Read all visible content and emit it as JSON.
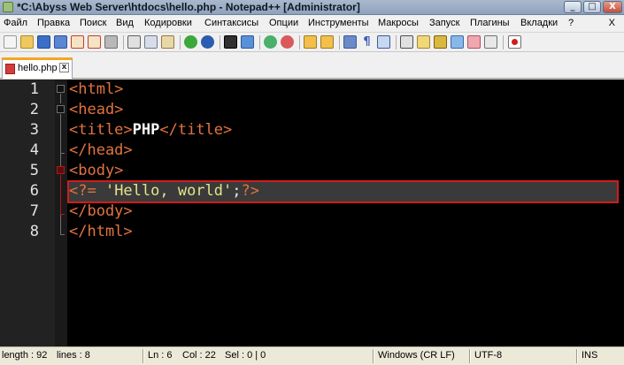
{
  "window": {
    "title": "*C:\\Abyss Web Server\\htdocs\\hello.php - Notepad++ [Administrator]",
    "minimize": "_",
    "maximize": "□",
    "close": "X"
  },
  "menu": {
    "items": [
      "Файл",
      "Правка",
      "Поиск",
      "Вид",
      "Кодировки",
      "Синтаксисы",
      "Опции",
      "Инструменты",
      "Макросы",
      "Запуск",
      "Плагины",
      "Вкладки",
      "?"
    ],
    "close_doc": "X"
  },
  "toolbar": {
    "icons": [
      "new-file-icon",
      "open-file-icon",
      "save-icon",
      "save-all-icon",
      "close-icon",
      "close-all-icon",
      "print-icon",
      "cut-icon",
      "copy-icon",
      "paste-icon",
      "undo-icon",
      "redo-icon",
      "find-icon",
      "replace-icon",
      "zoom-in-icon",
      "zoom-out-icon",
      "sync-vertical-icon",
      "sync-horizontal-icon",
      "word-wrap-icon",
      "show-all-chars-icon",
      "indent-guide-icon",
      "lang-icon",
      "doc-map-icon",
      "function-list-icon",
      "folder-as-workspace-icon",
      "monitor-icon",
      "record-macro-icon"
    ]
  },
  "tab": {
    "label": "hello.php",
    "close": "x"
  },
  "editor": {
    "line_numbers": [
      "1",
      "2",
      "3",
      "4",
      "5",
      "6",
      "7",
      "8"
    ],
    "lines": [
      {
        "parts": [
          [
            "tag",
            "<html>"
          ]
        ]
      },
      {
        "parts": [
          [
            "tag",
            "<head>"
          ]
        ]
      },
      {
        "parts": [
          [
            "tag",
            "<title>"
          ],
          [
            "txt",
            "PHP"
          ],
          [
            "tag",
            "</title>"
          ]
        ]
      },
      {
        "parts": [
          [
            "tag",
            "</head>"
          ]
        ]
      },
      {
        "parts": [
          [
            "tag",
            "<body>"
          ]
        ]
      },
      {
        "parts": [
          [
            "php",
            "<?= "
          ],
          [
            "str",
            "'Hello, world'"
          ],
          [
            "semi",
            ";"
          ],
          [
            "php",
            "?>"
          ]
        ]
      },
      {
        "parts": [
          [
            "tag",
            "</body>"
          ]
        ]
      },
      {
        "parts": [
          [
            "tag",
            "</html>"
          ]
        ]
      }
    ],
    "current_line": 6,
    "colors": {
      "background": "#000000",
      "tag": "#e2733f",
      "string": "#e6e28a",
      "text": "#ffffff",
      "highlight_border": "#d01c1c"
    }
  },
  "status": {
    "length": "length : 92",
    "lines": "lines : 8",
    "ln": "Ln : 6",
    "col": "Col : 22",
    "sel": "Sel : 0 | 0",
    "eol": "Windows (CR LF)",
    "encoding": "UTF-8",
    "mode": "INS"
  }
}
